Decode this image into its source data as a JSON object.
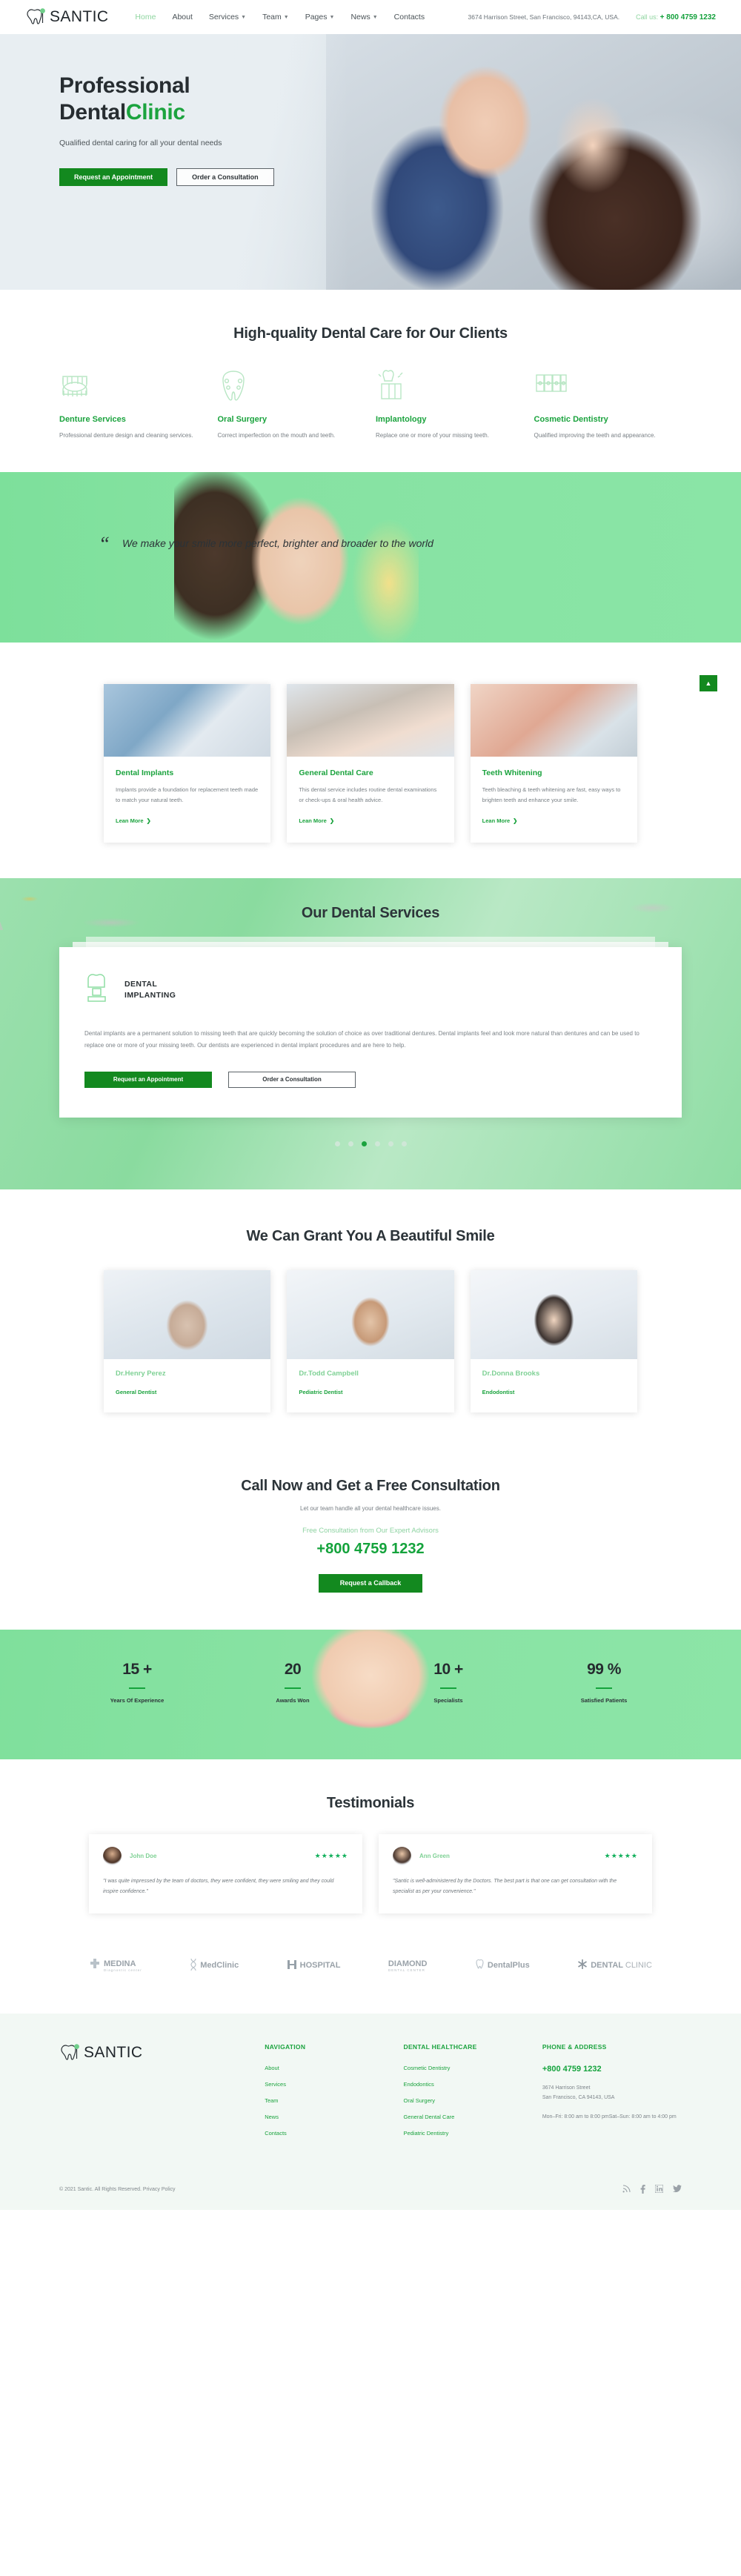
{
  "header": {
    "logo_text": "SANTIC",
    "nav": [
      {
        "label": "Home",
        "active": true,
        "caret": false
      },
      {
        "label": "About",
        "active": false,
        "caret": false
      },
      {
        "label": "Services",
        "active": false,
        "caret": true
      },
      {
        "label": "Team",
        "active": false,
        "caret": true
      },
      {
        "label": "Pages",
        "active": false,
        "caret": true
      },
      {
        "label": "News",
        "active": false,
        "caret": true
      },
      {
        "label": "Contacts",
        "active": false,
        "caret": false
      }
    ],
    "address": "3674 Harrison Street, San Francisco, 94143,CA, USA.",
    "call_label": "Call us:",
    "phone": "+ 800 4759 1232"
  },
  "hero": {
    "title_line1": "Professional",
    "title_line2_dark": "Dental",
    "title_line2_green": "Clinic",
    "subtitle": "Qualified dental caring for all your dental needs",
    "btn_primary": "Request an Appointment",
    "btn_secondary": "Order a Consultation"
  },
  "features": {
    "title": "High-quality Dental Care for Our Clients",
    "items": [
      {
        "icon": "denture-icon",
        "title": "Denture Services",
        "text": "Professional denture design and cleaning services."
      },
      {
        "icon": "oral-surgery-icon",
        "title": "Oral Surgery",
        "text": "Correct imperfection on the mouth and teeth."
      },
      {
        "icon": "implant-icon",
        "title": "Implantology",
        "text": "Replace one or more of your missing teeth."
      },
      {
        "icon": "braces-icon",
        "title": "Cosmetic Dentistry",
        "text": "Qualified improving the teeth and appearance."
      }
    ],
    "scroll_top": "▲"
  },
  "quote": {
    "mark": "“",
    "text": "We make your smile more perfect, brighter and broader to the world"
  },
  "cards": [
    {
      "title": "Dental Implants",
      "text": "Implants provide a foundation for replacement teeth made to match your natural teeth.",
      "link": "Lean More"
    },
    {
      "title": "General Dental Care",
      "text": "This dental service includes routine dental examinations or check-ups & oral health advice.",
      "link": "Lean More"
    },
    {
      "title": "Teeth Whitening",
      "text": "Teeth bleaching & teeth whitening are fast, easy ways to brighten teeth and enhance your smile.",
      "link": "Lean More"
    }
  ],
  "services": {
    "title": "Our Dental Services",
    "panel_title_l1": "DENTAL",
    "panel_title_l2": "IMPLANTING",
    "panel_text": "Dental implants are a permanent solution to missing teeth that are quickly becoming the solution of choice as over traditional dentures. Dental implants feel and look more natural than dentures and can be used to replace one or more of your missing teeth. Our dentists are experienced in dental implant procedures and are here to help.",
    "btn_primary": "Request an Appointment",
    "btn_secondary": "Order a Consultation",
    "dots": [
      false,
      false,
      true,
      false,
      false,
      false
    ]
  },
  "team": {
    "title": "We Can Grant You A Beautiful Smile",
    "members": [
      {
        "name": "Dr.Henry Perez",
        "role": "General Dentist"
      },
      {
        "name": "Dr.Todd Campbell",
        "role": "Pediatric Dentist"
      },
      {
        "name": "Dr.Donna Brooks",
        "role": "Endodontist"
      }
    ]
  },
  "cta": {
    "title": "Call Now and Get a Free Consultation",
    "subtitle": "Let our team handle all your dental healthcare issues.",
    "small": "Free Consultation from Our Expert Advisors",
    "phone": "+800 4759 1232",
    "button": "Request a Callback"
  },
  "stats": [
    {
      "number": "15 +",
      "label": "Years Of Experience"
    },
    {
      "number": "20",
      "label": "Awards Won"
    },
    {
      "number": "10 +",
      "label": "Specialists"
    },
    {
      "number": "99 %",
      "label": "Satisfied Patients"
    }
  ],
  "testimonials": {
    "title": "Testimonials",
    "items": [
      {
        "name": "John Doe",
        "stars": "★★★★★",
        "quote": "\"I was quite impressed by the team of doctors, they were confident, they were smiling and they could inspire confidence.\""
      },
      {
        "name": "Ann Green",
        "stars": "★★★★★",
        "quote": "\"Santic is well-administered by the Doctors. The best part is that one can get consultation with the specialist as per your convenience.\""
      }
    ]
  },
  "brands": [
    {
      "name": "MEDINA",
      "sub": "Diagnostic center",
      "icon": "cross-icon"
    },
    {
      "name": "MedClinic",
      "sub": "",
      "icon": "dna-icon"
    },
    {
      "name": "HOSPITAL",
      "sub": "",
      "icon": "h-icon"
    },
    {
      "name": "DIAMOND",
      "sub": "DENTAL CENTER",
      "icon": ""
    },
    {
      "name": "DentalPlus",
      "sub": "",
      "icon": "tooth-icon"
    },
    {
      "name": "DENTAL CLINIC",
      "sub": "",
      "icon": "asterisk-icon"
    }
  ],
  "footer": {
    "logo_text": "SANTIC",
    "col_nav_title": "NAVIGATION",
    "col_nav": [
      "About",
      "Services",
      "Team",
      "News",
      "Contacts"
    ],
    "col_care_title": "DENTAL HEALTHCARE",
    "col_care": [
      "Cosmetic Dentistry",
      "Endodontics",
      "Oral Surgery",
      "General Dental Care",
      "Pediatric Dentistry"
    ],
    "col_contact_title": "PHONE & ADDRESS",
    "phone": "+800 4759 1232",
    "address_l1": "3674 Harrison Street",
    "address_l2": "San Francisco, CA 94143, USA",
    "hours": "Mon–Fri: 8:00 am to 8:00 pmSat–Sun: 8:00 am to 4:00 pm",
    "copyright": "© 2021 Santic. All Rights Reserved. Privacy Policy",
    "social": [
      "rss-icon",
      "facebook-icon",
      "linkedin-icon",
      "twitter-icon"
    ]
  },
  "colors": {
    "green": "#1ba33e",
    "green_dark": "#13891f",
    "mint": "#8ae5a6",
    "light_green": "#8fd5a0"
  }
}
